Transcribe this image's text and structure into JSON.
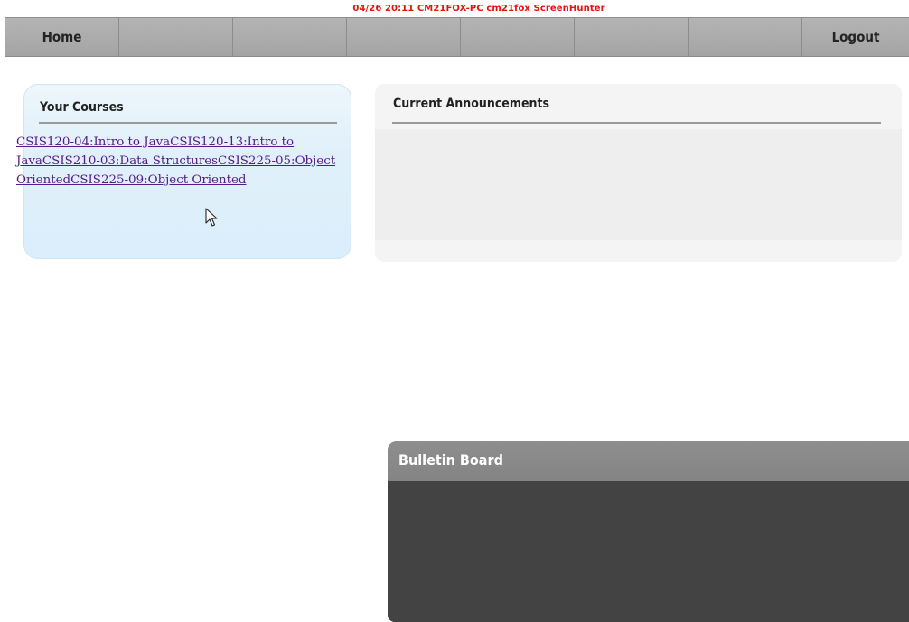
{
  "capture_stamp": "04/26  20:11  CM21FOX-PC  cm21fox  ScreenHunter",
  "nav": {
    "items": [
      {
        "label": "Home"
      },
      {
        "label": ""
      },
      {
        "label": ""
      },
      {
        "label": ""
      },
      {
        "label": ""
      },
      {
        "label": ""
      },
      {
        "label": ""
      },
      {
        "label": "Logout"
      }
    ]
  },
  "courses": {
    "title": "Your Courses",
    "links": [
      "CSIS120-04:Intro to Java",
      "CSIS120-13:Intro to Java",
      "CSIS210-03:Data Structures",
      "CSIS225-05:Object Oriented",
      "CSIS225-09:Object Oriented"
    ]
  },
  "announcements": {
    "title": "Current Announcements"
  },
  "bulletin": {
    "title": "Bulletin Board"
  },
  "icons": {
    "cursor": "mouse-pointer-icon"
  },
  "colors": {
    "stamp_red": "#e8120c",
    "nav_gray": "#a8a8a8",
    "courses_panel": "#e0f0fa",
    "link_purple": "#551a8b",
    "announce_panel": "#f4f4f4",
    "bulletin_header": "#8a8a8a",
    "bulletin_body": "#434343"
  }
}
